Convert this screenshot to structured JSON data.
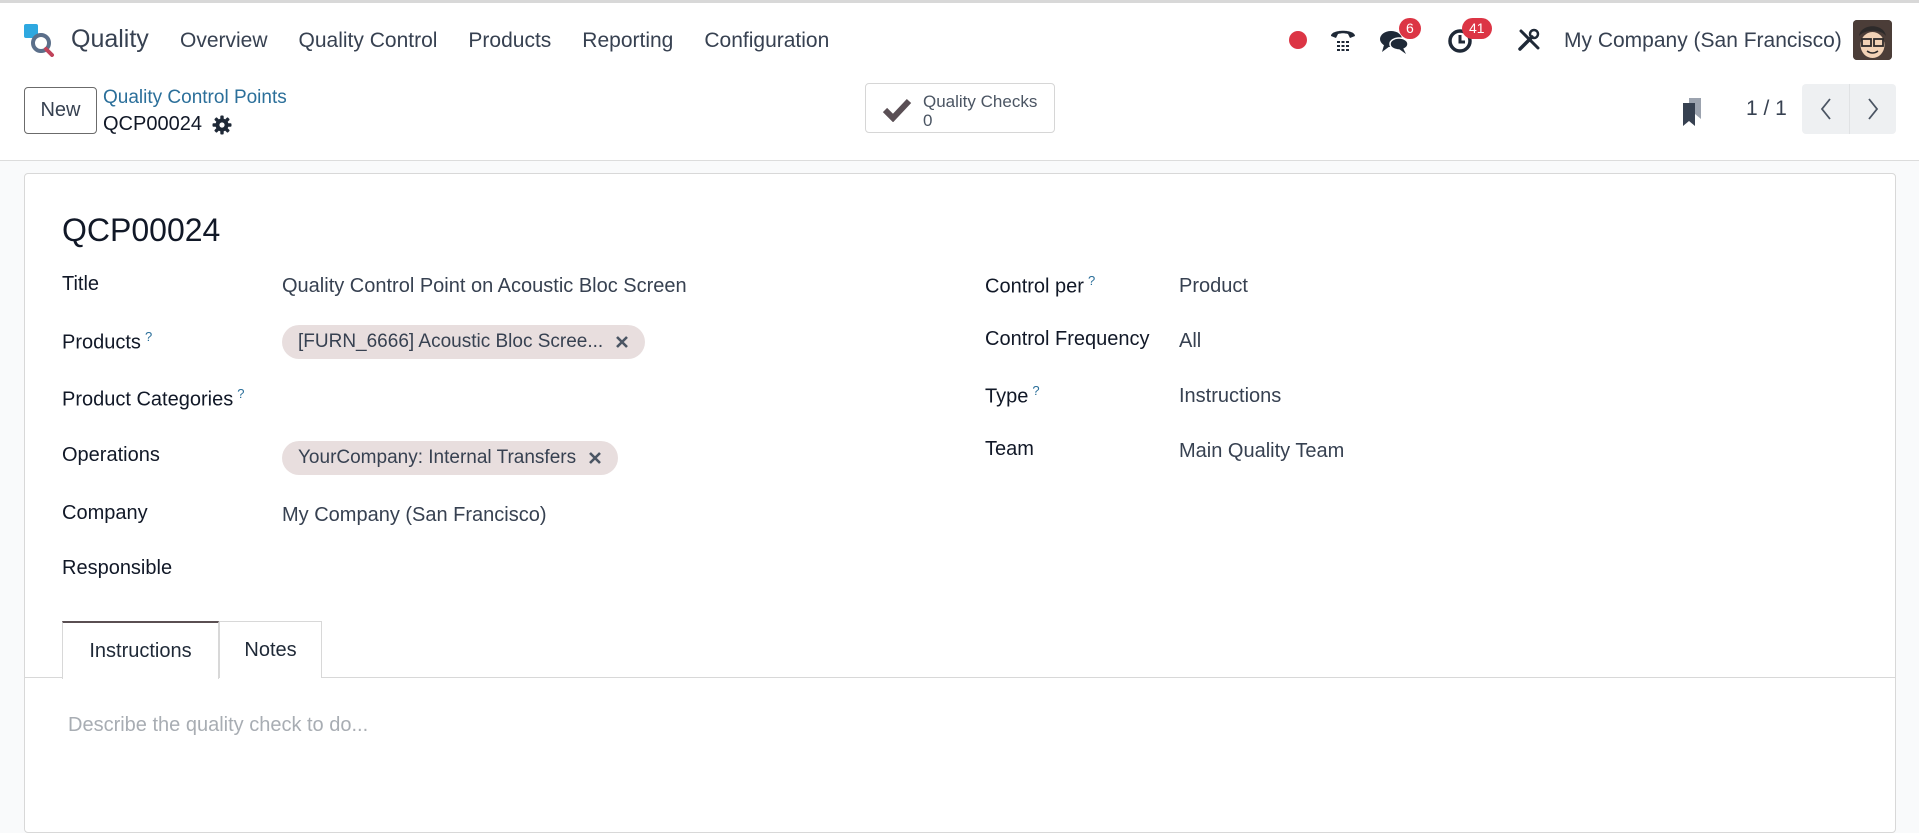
{
  "navbar": {
    "app_name": "Quality",
    "menu": [
      "Overview",
      "Quality Control",
      "Products",
      "Reporting",
      "Configuration"
    ],
    "icons": [
      "recording-dot-icon",
      "phone-icon",
      "chat-icon",
      "activity-clock-icon",
      "tools-icon"
    ],
    "messages_badge": "6",
    "activities_badge": "41",
    "company": "My Company (San Francisco)"
  },
  "control_panel": {
    "new_label": "New",
    "breadcrumb_parent": "Quality Control Points",
    "record_name": "QCP00024",
    "smart_button": {
      "label": "Quality Checks",
      "value": "0"
    },
    "pager": "1 / 1"
  },
  "form": {
    "title": "QCP00024",
    "left_fields": {
      "title": {
        "label": "Title",
        "value": "Quality Control Point on Acoustic Bloc Screen"
      },
      "products": {
        "label": "Products",
        "help": "?",
        "tags": [
          "[FURN_6666] Acoustic Bloc Scree..."
        ]
      },
      "product_categories": {
        "label": "Product Categories",
        "help": "?",
        "value": ""
      },
      "operations": {
        "label": "Operations",
        "tags": [
          "YourCompany: Internal Transfers"
        ]
      },
      "company": {
        "label": "Company",
        "value": "My Company (San Francisco)"
      },
      "responsible": {
        "label": "Responsible",
        "value": ""
      }
    },
    "right_fields": {
      "control_per": {
        "label": "Control per",
        "help": "?",
        "value": "Product"
      },
      "control_frequency": {
        "label": "Control Frequency",
        "value": "All"
      },
      "type": {
        "label": "Type",
        "help": "?",
        "value": "Instructions"
      },
      "team": {
        "label": "Team",
        "value": "Main Quality Team"
      }
    },
    "tabs": [
      {
        "label": "Instructions",
        "active": true
      },
      {
        "label": "Notes",
        "active": false
      }
    ],
    "instructions_placeholder": "Describe the quality check to do..."
  },
  "colors": {
    "accent_link": "#2b6f9a",
    "badge": "#dc3545",
    "tag_bg": "#e8dede"
  }
}
